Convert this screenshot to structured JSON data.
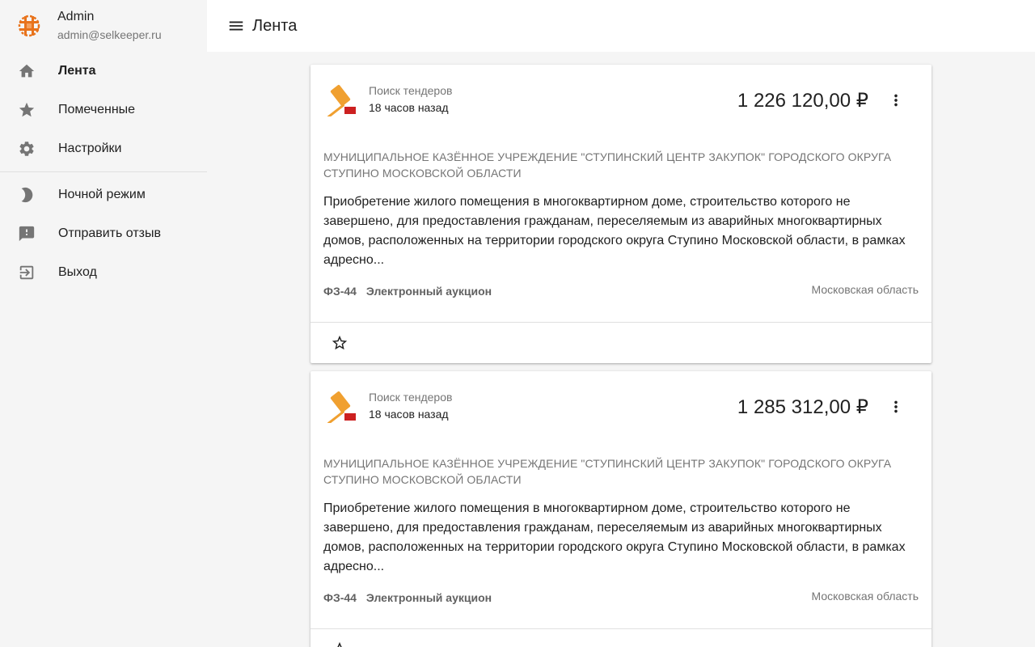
{
  "user": {
    "name": "Admin",
    "email": "admin@selkeeper.ru"
  },
  "sidebar": {
    "items": [
      {
        "label": "Лента",
        "icon": "home-icon",
        "active": true
      },
      {
        "label": "Помеченные",
        "icon": "star-icon"
      },
      {
        "label": "Настройки",
        "icon": "gear-icon"
      }
    ],
    "items2": [
      {
        "label": "Ночной режим",
        "icon": "moon-icon"
      },
      {
        "label": "Отправить отзыв",
        "icon": "feedback-icon"
      },
      {
        "label": "Выход",
        "icon": "logout-icon"
      }
    ]
  },
  "header": {
    "title": "Лента"
  },
  "feed": {
    "cards": [
      {
        "source": "Поиск тендеров",
        "time": "18 часов назад",
        "price": "1 226 120,00 ₽",
        "customer": "МУНИЦИПАЛЬНОЕ КАЗЁННОЕ УЧРЕЖДЕНИЕ \"СТУПИНСКИЙ ЦЕНТР ЗАКУПОК\" ГОРОДСКОГО ОКРУГА СТУПИНО МОСКОВСКОЙ ОБЛАСТИ",
        "description": "Приобретение жилого помещения в многоквартирном доме, строительство которого не завершено, для предоставления гражданам, переселяемым из аварийных многоквартирных домов, расположенных на территории городского округа Ступино Московской области, в рамках адресно...",
        "law": "ФЗ-44",
        "procedure": "Электронный аукцион",
        "region": "Московская область"
      },
      {
        "source": "Поиск тендеров",
        "time": "18 часов назад",
        "price": "1 285 312,00 ₽",
        "customer": "МУНИЦИПАЛЬНОЕ КАЗЁННОЕ УЧРЕЖДЕНИЕ \"СТУПИНСКИЙ ЦЕНТР ЗАКУПОК\" ГОРОДСКОГО ОКРУГА СТУПИНО МОСКОВСКОЙ ОБЛАСТИ",
        "description": "Приобретение жилого помещения в многоквартирном доме, строительство которого не завершено, для предоставления гражданам, переселяемым из аварийных многоквартирных домов, расположенных на территории городского округа Ступино Московской области, в рамках адресно...",
        "law": "ФЗ-44",
        "procedure": "Электронный аукцион",
        "region": "Московская область"
      }
    ]
  },
  "colors": {
    "logo_orange": "#e8731c",
    "gavel_gold": "#f0a030",
    "gavel_base": "#cc2020"
  }
}
